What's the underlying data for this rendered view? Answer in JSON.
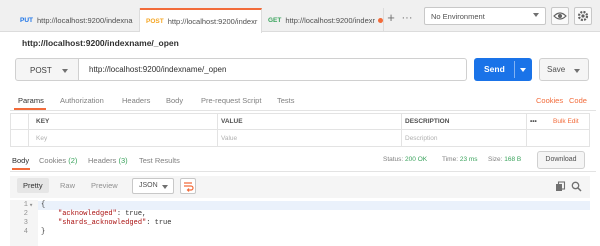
{
  "tabs": [
    {
      "method": "PUT",
      "method_color": "#1a73e8",
      "label": "http://localhost:9200/indexna",
      "active": false
    },
    {
      "method": "POST",
      "method_color": "#f5a623",
      "label": "http://localhost:9200/indexr",
      "active": true
    },
    {
      "method": "GET",
      "method_color": "#3aa35c",
      "label": "http://localhost:9200/indexr",
      "active": false
    }
  ],
  "environment": {
    "selected": "No Environment"
  },
  "request": {
    "title": "http://localhost:9200/indexname/_open",
    "method": "POST",
    "url": "http://localhost:9200/indexname/_open",
    "send_label": "Send",
    "save_label": "Save"
  },
  "request_tabs": [
    "Params",
    "Authorization",
    "Headers",
    "Body",
    "Pre-request Script",
    "Tests"
  ],
  "request_links": {
    "cookies": "Cookies",
    "code": "Code"
  },
  "params": {
    "headers": {
      "key": "KEY",
      "value": "VALUE",
      "description": "DESCRIPTION",
      "more": "•••",
      "bulk_edit": "Bulk Edit"
    },
    "placeholders": {
      "key": "Key",
      "value": "Value",
      "description": "Description"
    }
  },
  "response_tabs": {
    "body": "Body",
    "cookies": "Cookies",
    "cookies_count": "(2)",
    "headers": "Headers",
    "headers_count": "(3)",
    "test_results": "Test Results"
  },
  "status": {
    "status_label": "Status:",
    "status_value": "200 OK",
    "time_label": "Time:",
    "time_value": "23 ms",
    "size_label": "Size:",
    "size_value": "168 B",
    "download_label": "Download"
  },
  "body_view": {
    "modes": [
      "Pretty",
      "Raw",
      "Preview"
    ],
    "active_mode": "Pretty",
    "format": "JSON"
  },
  "code_lines": [
    {
      "num": "1",
      "fold": "▾",
      "text": "{"
    },
    {
      "num": "2",
      "key": "\"acknowledged\"",
      "rest": ": true,"
    },
    {
      "num": "3",
      "key": "\"shards_acknowledged\"",
      "rest": ": true"
    },
    {
      "num": "4",
      "text": "}"
    }
  ],
  "colors": {
    "accent": "#f26b3a",
    "send": "#1a73e8",
    "success": "#3aa35c"
  }
}
